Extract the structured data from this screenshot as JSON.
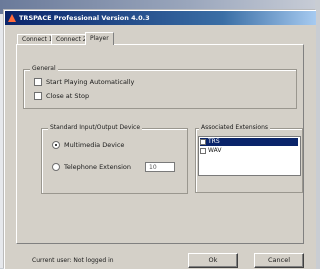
{
  "window": {
    "title": "TRSPACE Professional Version 4.0.3"
  },
  "tabs": [
    {
      "label": "Connect 1"
    },
    {
      "label": "Connect 2"
    },
    {
      "label": "Player"
    }
  ],
  "general": {
    "title": "General",
    "options": [
      {
        "label": "Start Playing Automatically",
        "checked": false
      },
      {
        "label": "Close at Stop",
        "checked": false
      }
    ]
  },
  "io": {
    "title": "Standard Input/Output Device",
    "options": [
      {
        "label": "Multimedia Device",
        "selected": true
      },
      {
        "label": "Telephone Extension",
        "selected": false
      }
    ],
    "extension_value": "10"
  },
  "associated": {
    "title": "Associated Extensions",
    "items": [
      {
        "label": "TRS",
        "selected": true
      },
      {
        "label": "WAV",
        "selected": false
      }
    ]
  },
  "status": {
    "text": "Current user: Not logged in"
  },
  "buttons": {
    "ok": "Ok",
    "cancel": "Cancel"
  }
}
